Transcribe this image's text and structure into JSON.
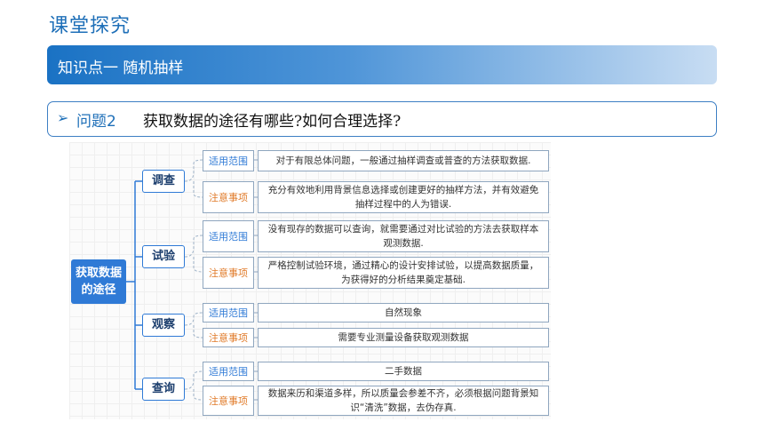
{
  "header": {
    "title": "课堂探究"
  },
  "banner": {
    "text": "知识点一 随机抽样"
  },
  "question": {
    "arrow": "➢",
    "label": "问题2",
    "text": "获取数据的途径有哪些?如何合理选择?"
  },
  "diagram": {
    "root": "获取数据的途径",
    "categories": [
      {
        "name": "调查",
        "scope_label": "适用范围",
        "scope": "对于有限总体问题，一般通过抽样调查或普查的方法获取数据.",
        "note_label": "注意事项",
        "note": "充分有效地利用背景信息选择或创建更好的抽样方法，并有效避免抽样过程中的人为错误."
      },
      {
        "name": "试验",
        "scope_label": "适用范围",
        "scope": "没有现存的数据可以查询，就需要通过对比试验的方法去获取样本观测数据.",
        "note_label": "注意事项",
        "note": "严格控制试验环境，通过精心的设计安排试验，以提高数据质量，为获得好的分析结果奠定基础."
      },
      {
        "name": "观察",
        "scope_label": "适用范围",
        "scope": "自然现象",
        "note_label": "注意事项",
        "note": "需要专业测量设备获取观测数据"
      },
      {
        "name": "查询",
        "scope_label": "适用范围",
        "scope": "二手数据",
        "note_label": "注意事项",
        "note": "数据来历和渠道多样，所以质量会参差不齐，必须根据问题背景知识“清洗”数据，去伪存真."
      }
    ]
  },
  "colors": {
    "primary": "#1e6fb8",
    "node_blue": "#2f7ad6",
    "label_orange": "#e07b2a"
  }
}
